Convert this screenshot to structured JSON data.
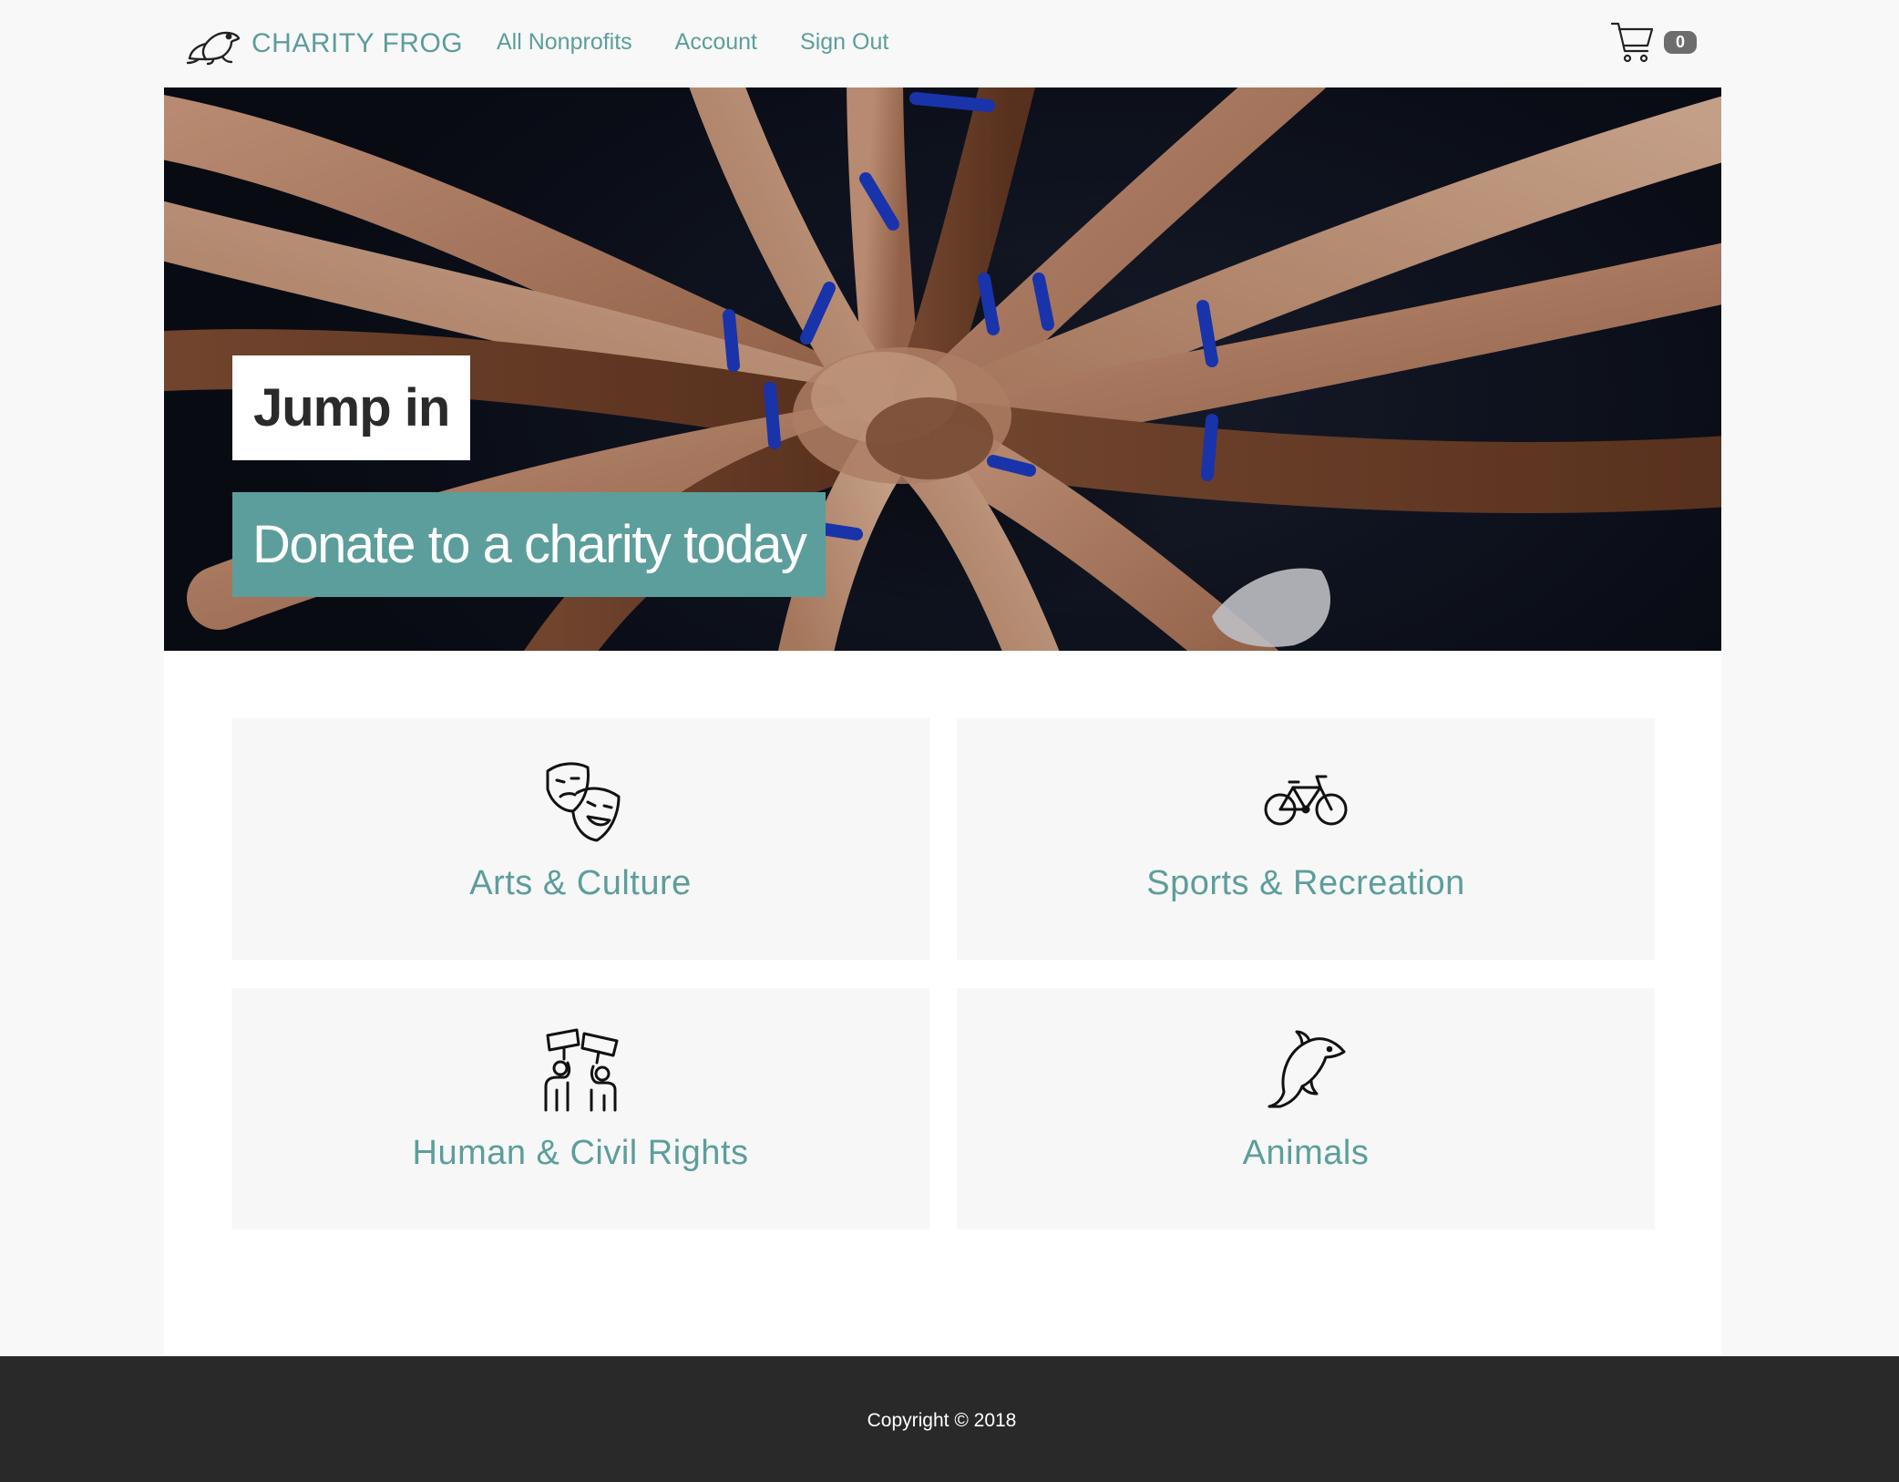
{
  "navbar": {
    "brand": "CHARITY FROG",
    "links": [
      "All Nonprofits",
      "Account",
      "Sign Out"
    ],
    "cart_count": "0"
  },
  "hero": {
    "title": "Jump in",
    "cta": "Donate to a charity today"
  },
  "categories": [
    {
      "label": "Arts & Culture",
      "icon": "theater-masks-icon"
    },
    {
      "label": "Sports & Recreation",
      "icon": "bicycle-icon"
    },
    {
      "label": "Human & Civil Rights",
      "icon": "protest-icon"
    },
    {
      "label": "Animals",
      "icon": "dolphin-icon"
    }
  ],
  "footer": {
    "copyright": "Copyright © 2018"
  },
  "colors": {
    "accent": "#5c9e9b",
    "page_background": "#f8f8f8",
    "footer_background": "#292929",
    "badge": "#6d6d6d"
  }
}
